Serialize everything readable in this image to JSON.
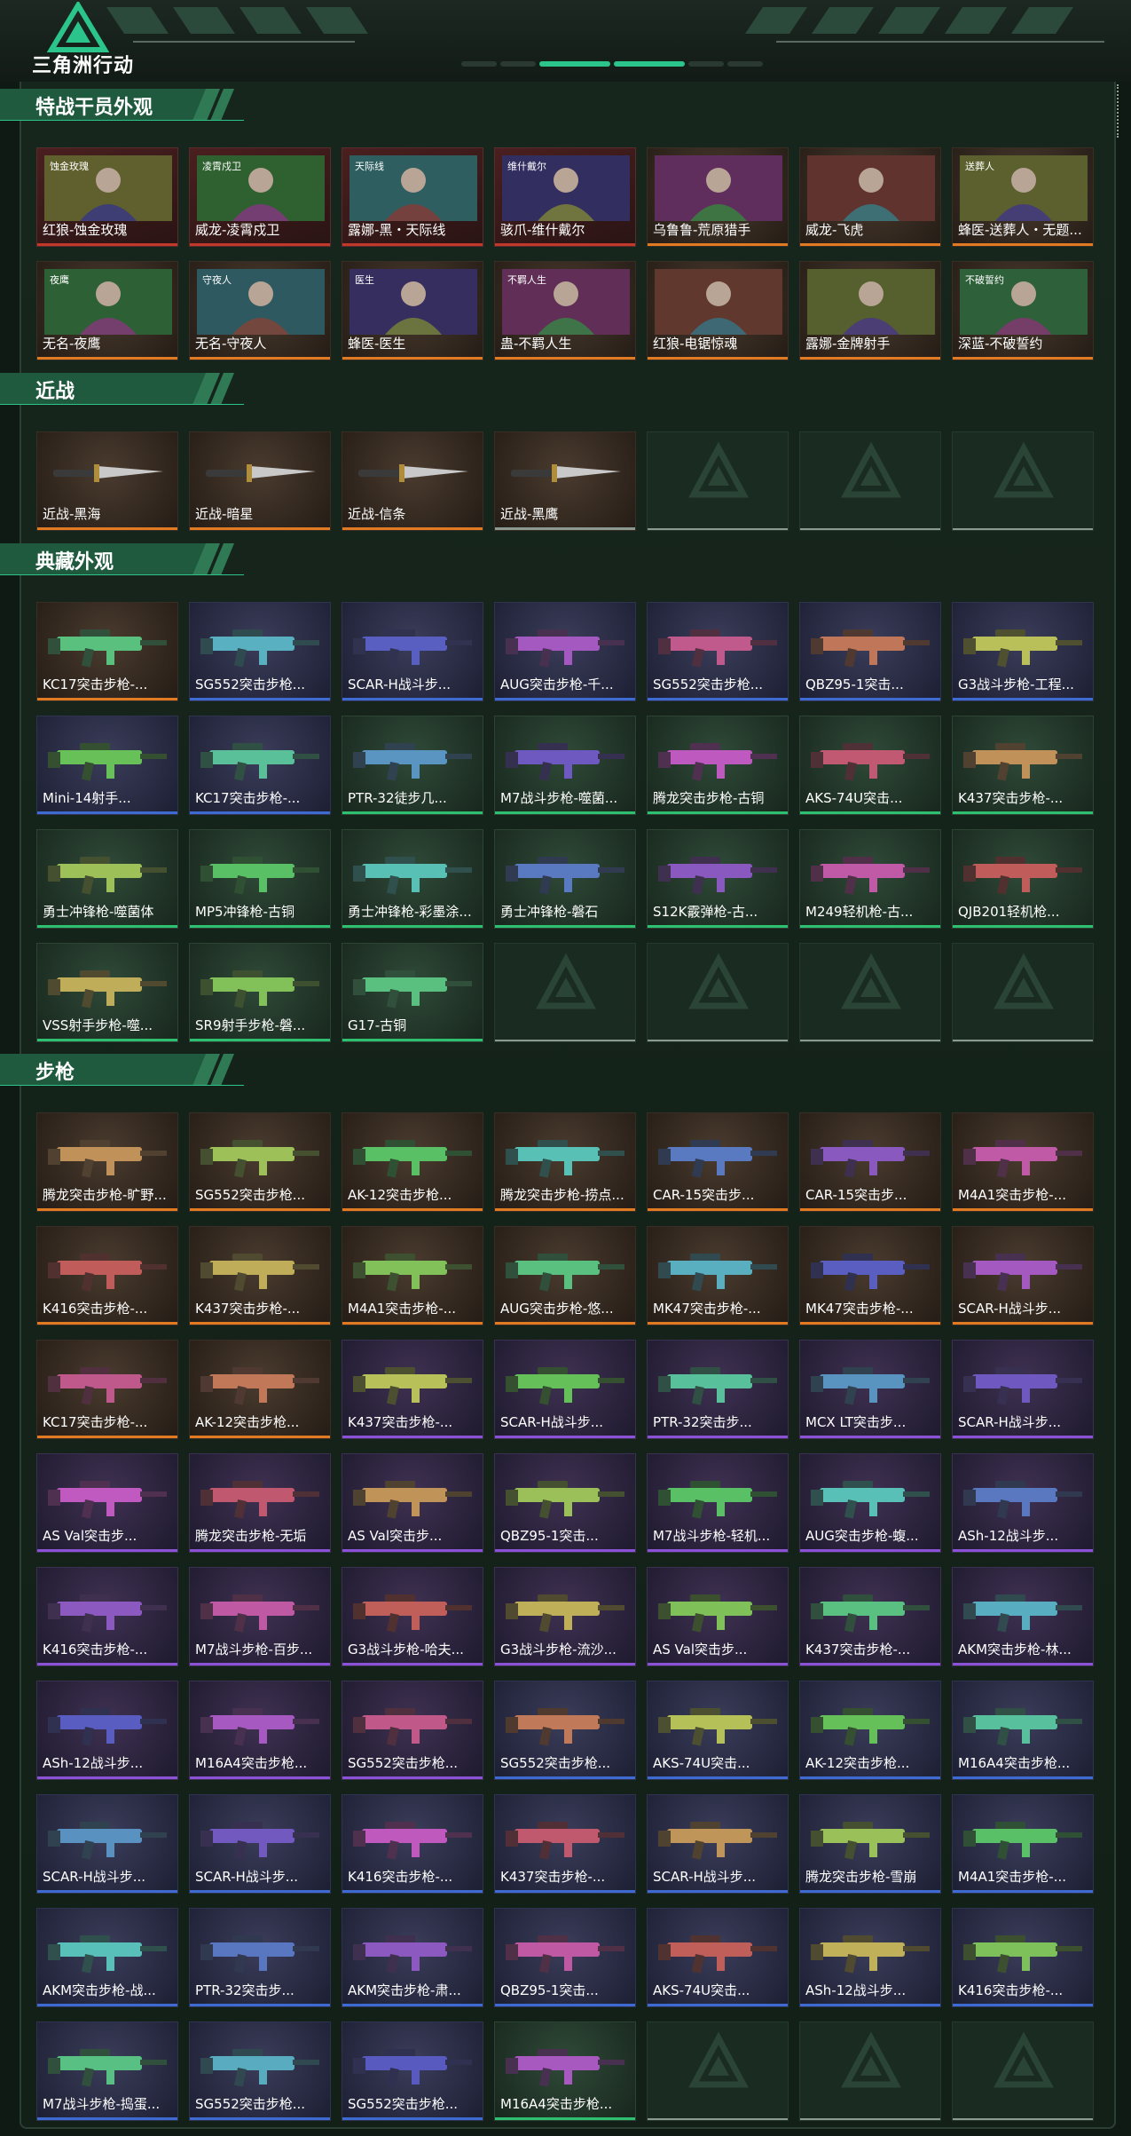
{
  "app": {
    "title": "三角洲行动"
  },
  "colors": {
    "accent": "#2bc48a",
    "rarity_red": "#c0392b",
    "rarity_orange": "#e07b24",
    "rarity_purple": "#8c52d6",
    "rarity_blue": "#3d6bd1",
    "rarity_green": "#2fbf71",
    "rarity_gray": "#8b9990"
  },
  "sections": [
    {
      "title": "特战干员外观",
      "kind": "operator",
      "items": [
        {
          "label": "红狼-蚀金玫瑰",
          "rarity": "red",
          "overlay": "蚀金玫瑰"
        },
        {
          "label": "威龙-凌霄戍卫",
          "rarity": "red",
          "overlay": "凌霄戍卫"
        },
        {
          "label": "露娜-黑・天际线",
          "rarity": "red",
          "overlay": "天际线"
        },
        {
          "label": "骇爪-维什戴尔",
          "rarity": "red",
          "overlay": "维什戴尔"
        },
        {
          "label": "乌鲁鲁-荒原猎手",
          "rarity": "orange",
          "overlay": ""
        },
        {
          "label": "威龙-飞虎",
          "rarity": "orange",
          "overlay": ""
        },
        {
          "label": "蜂医-送葬人・无题...",
          "rarity": "orange",
          "overlay": "送葬人"
        },
        {
          "label": "无名-夜鹰",
          "rarity": "orange",
          "overlay": "夜鹰"
        },
        {
          "label": "无名-守夜人",
          "rarity": "orange",
          "overlay": "守夜人"
        },
        {
          "label": "蜂医-医生",
          "rarity": "orange",
          "overlay": "医生"
        },
        {
          "label": "蛊-不羁人生",
          "rarity": "orange",
          "overlay": "不羁人生"
        },
        {
          "label": "红狼-电锯惊魂",
          "rarity": "orange",
          "overlay": ""
        },
        {
          "label": "露娜-金牌射手",
          "rarity": "orange",
          "overlay": ""
        },
        {
          "label": "深蓝-不破誓约",
          "rarity": "orange",
          "overlay": "不破誓约"
        }
      ]
    },
    {
      "title": "近战",
      "kind": "melee",
      "items": [
        {
          "label": "近战-黑海",
          "rarity": "orange"
        },
        {
          "label": "近战-暗星",
          "rarity": "orange"
        },
        {
          "label": "近战-信条",
          "rarity": "orange"
        },
        {
          "label": "近战-黑鹰",
          "rarity": "gray"
        },
        {
          "label": "",
          "rarity": "empty"
        },
        {
          "label": "",
          "rarity": "empty"
        },
        {
          "label": "",
          "rarity": "empty"
        }
      ]
    },
    {
      "title": "典藏外观",
      "kind": "weapon",
      "items": [
        {
          "label": "KC17突击步枪-...",
          "rarity": "orange"
        },
        {
          "label": "SG552突击步枪...",
          "rarity": "blue"
        },
        {
          "label": "SCAR-H战斗步...",
          "rarity": "blue"
        },
        {
          "label": "AUG突击步枪-千...",
          "rarity": "blue"
        },
        {
          "label": "SG552突击步枪...",
          "rarity": "blue"
        },
        {
          "label": "QBZ95-1突击...",
          "rarity": "blue"
        },
        {
          "label": "G3战斗步枪-工程...",
          "rarity": "blue"
        },
        {
          "label": "Mini-14射手...",
          "rarity": "blue"
        },
        {
          "label": "KC17突击步枪-...",
          "rarity": "blue"
        },
        {
          "label": "PTR-32徒步几...",
          "rarity": "green"
        },
        {
          "label": "M7战斗步枪-噬菌...",
          "rarity": "green"
        },
        {
          "label": "腾龙突击步枪-古铜",
          "rarity": "green"
        },
        {
          "label": "AKS-74U突击...",
          "rarity": "green"
        },
        {
          "label": "K437突击步枪-...",
          "rarity": "green"
        },
        {
          "label": "勇士冲锋枪-噬菌体",
          "rarity": "green"
        },
        {
          "label": "MP5冲锋枪-古铜",
          "rarity": "green"
        },
        {
          "label": "勇士冲锋枪-彩墨涂...",
          "rarity": "green"
        },
        {
          "label": "勇士冲锋枪-磐石",
          "rarity": "green"
        },
        {
          "label": "S12K霰弹枪-古...",
          "rarity": "green"
        },
        {
          "label": "M249轻机枪-古...",
          "rarity": "green"
        },
        {
          "label": "QJB201轻机枪...",
          "rarity": "green"
        },
        {
          "label": "VSS射手步枪-噬...",
          "rarity": "green"
        },
        {
          "label": "SR9射手步枪-磐...",
          "rarity": "green"
        },
        {
          "label": "G17-古铜",
          "rarity": "green"
        },
        {
          "label": "",
          "rarity": "empty"
        },
        {
          "label": "",
          "rarity": "empty"
        },
        {
          "label": "",
          "rarity": "empty"
        },
        {
          "label": "",
          "rarity": "empty"
        }
      ]
    },
    {
      "title": "步枪",
      "kind": "weapon",
      "items": [
        {
          "label": "腾龙突击步枪-旷野...",
          "rarity": "orange"
        },
        {
          "label": "SG552突击步枪...",
          "rarity": "orange"
        },
        {
          "label": "AK-12突击步枪...",
          "rarity": "orange"
        },
        {
          "label": "腾龙突击步枪-捞点...",
          "rarity": "orange"
        },
        {
          "label": "CAR-15突击步...",
          "rarity": "orange"
        },
        {
          "label": "CAR-15突击步...",
          "rarity": "orange"
        },
        {
          "label": "M4A1突击步枪-...",
          "rarity": "orange"
        },
        {
          "label": "K416突击步枪-...",
          "rarity": "orange"
        },
        {
          "label": "K437突击步枪-...",
          "rarity": "orange"
        },
        {
          "label": "M4A1突击步枪-...",
          "rarity": "orange"
        },
        {
          "label": "AUG突击步枪-悠...",
          "rarity": "orange"
        },
        {
          "label": "MK47突击步枪-...",
          "rarity": "orange"
        },
        {
          "label": "MK47突击步枪-...",
          "rarity": "orange"
        },
        {
          "label": "SCAR-H战斗步...",
          "rarity": "orange"
        },
        {
          "label": "KC17突击步枪-...",
          "rarity": "orange"
        },
        {
          "label": "AK-12突击步枪...",
          "rarity": "orange"
        },
        {
          "label": "K437突击步枪-...",
          "rarity": "purple"
        },
        {
          "label": "SCAR-H战斗步...",
          "rarity": "purple"
        },
        {
          "label": "PTR-32突击步...",
          "rarity": "purple"
        },
        {
          "label": "MCX LT突击步...",
          "rarity": "purple"
        },
        {
          "label": "SCAR-H战斗步...",
          "rarity": "purple"
        },
        {
          "label": "AS Val突击步...",
          "rarity": "purple"
        },
        {
          "label": "腾龙突击步枪-无垢",
          "rarity": "purple"
        },
        {
          "label": "AS Val突击步...",
          "rarity": "purple"
        },
        {
          "label": "QBZ95-1突击...",
          "rarity": "purple"
        },
        {
          "label": "M7战斗步枪-轻机...",
          "rarity": "purple"
        },
        {
          "label": "AUG突击步枪-蝮...",
          "rarity": "purple"
        },
        {
          "label": "ASh-12战斗步...",
          "rarity": "purple"
        },
        {
          "label": "K416突击步枪-...",
          "rarity": "purple"
        },
        {
          "label": "M7战斗步枪-百步...",
          "rarity": "purple"
        },
        {
          "label": "G3战斗步枪-哈夫...",
          "rarity": "purple"
        },
        {
          "label": "G3战斗步枪-流沙...",
          "rarity": "purple"
        },
        {
          "label": "AS Val突击步...",
          "rarity": "purple"
        },
        {
          "label": "K437突击步枪-...",
          "rarity": "purple"
        },
        {
          "label": "AKM突击步枪-林...",
          "rarity": "purple"
        },
        {
          "label": "ASh-12战斗步...",
          "rarity": "purple"
        },
        {
          "label": "M16A4突击步枪...",
          "rarity": "purple"
        },
        {
          "label": "SG552突击步枪...",
          "rarity": "purple"
        },
        {
          "label": "SG552突击步枪...",
          "rarity": "blue"
        },
        {
          "label": "AKS-74U突击...",
          "rarity": "blue"
        },
        {
          "label": "AK-12突击步枪...",
          "rarity": "blue"
        },
        {
          "label": "M16A4突击步枪...",
          "rarity": "blue"
        },
        {
          "label": "SCAR-H战斗步...",
          "rarity": "blue"
        },
        {
          "label": "SCAR-H战斗步...",
          "rarity": "blue"
        },
        {
          "label": "K416突击步枪-...",
          "rarity": "blue"
        },
        {
          "label": "K437突击步枪-...",
          "rarity": "blue"
        },
        {
          "label": "SCAR-H战斗步...",
          "rarity": "blue"
        },
        {
          "label": "腾龙突击步枪-雪崩",
          "rarity": "blue"
        },
        {
          "label": "M4A1突击步枪-...",
          "rarity": "blue"
        },
        {
          "label": "AKM突击步枪-战...",
          "rarity": "blue"
        },
        {
          "label": "PTR-32突击步...",
          "rarity": "blue"
        },
        {
          "label": "AKM突击步枪-肃...",
          "rarity": "blue"
        },
        {
          "label": "QBZ95-1突击...",
          "rarity": "blue"
        },
        {
          "label": "AKS-74U突击...",
          "rarity": "blue"
        },
        {
          "label": "ASh-12战斗步...",
          "rarity": "blue"
        },
        {
          "label": "K416突击步枪-...",
          "rarity": "blue"
        },
        {
          "label": "M7战斗步枪-捣蛋...",
          "rarity": "blue"
        },
        {
          "label": "SG552突击步枪...",
          "rarity": "blue"
        },
        {
          "label": "SG552突击步枪...",
          "rarity": "blue"
        },
        {
          "label": "M16A4突击步枪...",
          "rarity": "green"
        },
        {
          "label": "",
          "rarity": "empty"
        },
        {
          "label": "",
          "rarity": "empty"
        },
        {
          "label": "",
          "rarity": "empty"
        }
      ]
    }
  ]
}
